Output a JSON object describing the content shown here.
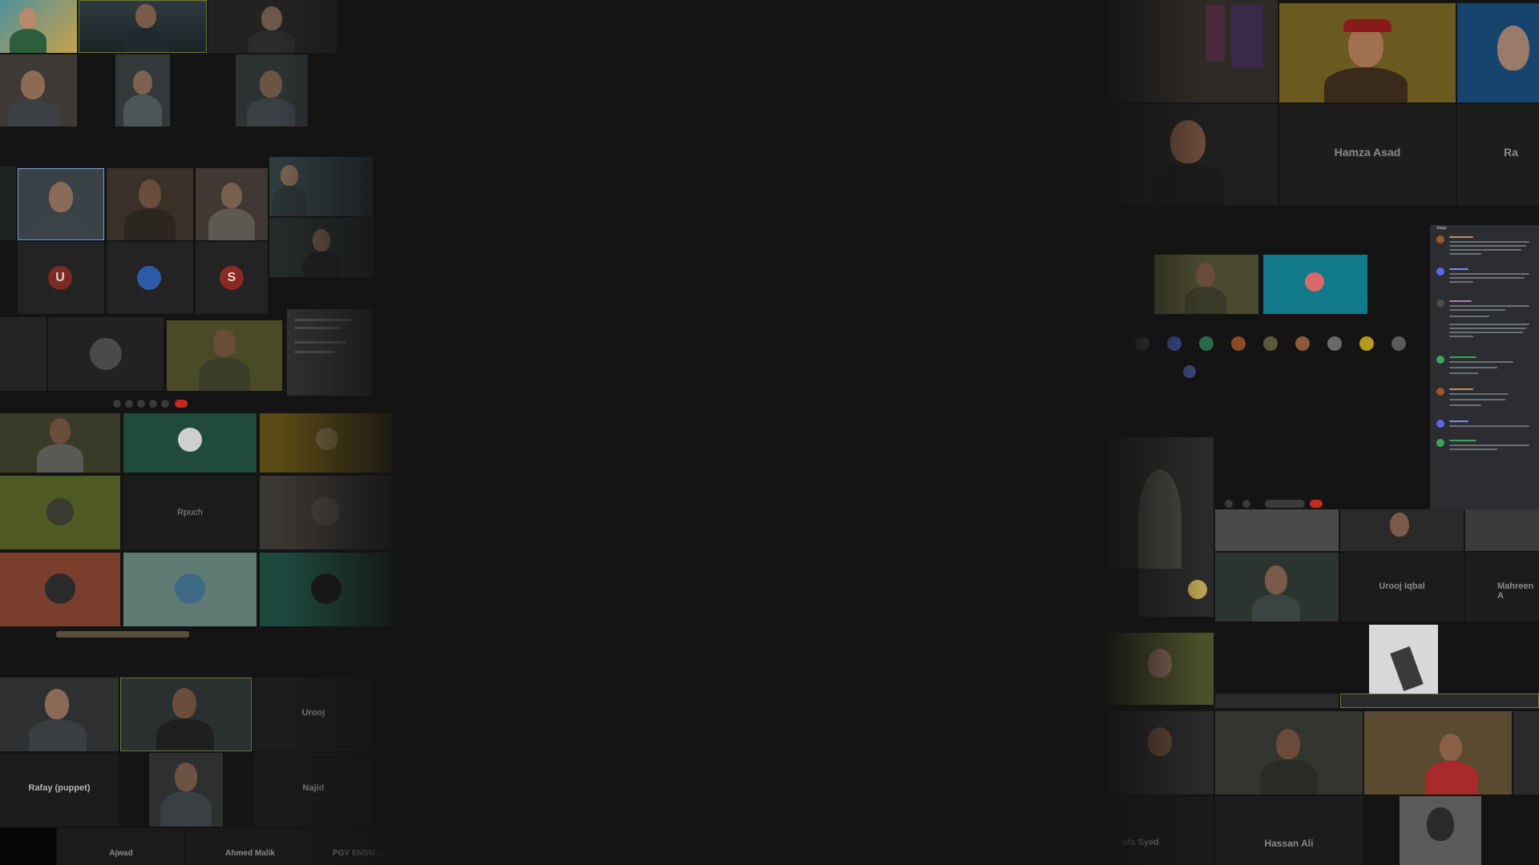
{
  "left_collage": {
    "name_tiles": [
      {
        "label": "Urooj"
      },
      {
        "label": "Rafay (puppet)"
      },
      {
        "label": "Najid"
      },
      {
        "label": "Ajwad"
      },
      {
        "label": "Ahmed Malik"
      },
      {
        "label": "PGV ENSM ..."
      }
    ],
    "avatar_letters": [
      "U",
      "S"
    ],
    "discord_label": "Rpuch"
  },
  "right_collage": {
    "name_tiles": [
      {
        "label": "Hamza Asad"
      },
      {
        "label": "Ra"
      },
      {
        "label": "Urooj Iqbal"
      },
      {
        "label": "Mahreen A"
      },
      {
        "label": "Hassan Ali"
      },
      {
        "label": "ufa Syed"
      }
    ],
    "chat_header": "Stage",
    "colors": {
      "accent_green": "#6c7a2c",
      "discord_blurple": "#5865f2",
      "end_call_red": "#c42b1c",
      "panel_bg": "#2b2d31"
    }
  }
}
